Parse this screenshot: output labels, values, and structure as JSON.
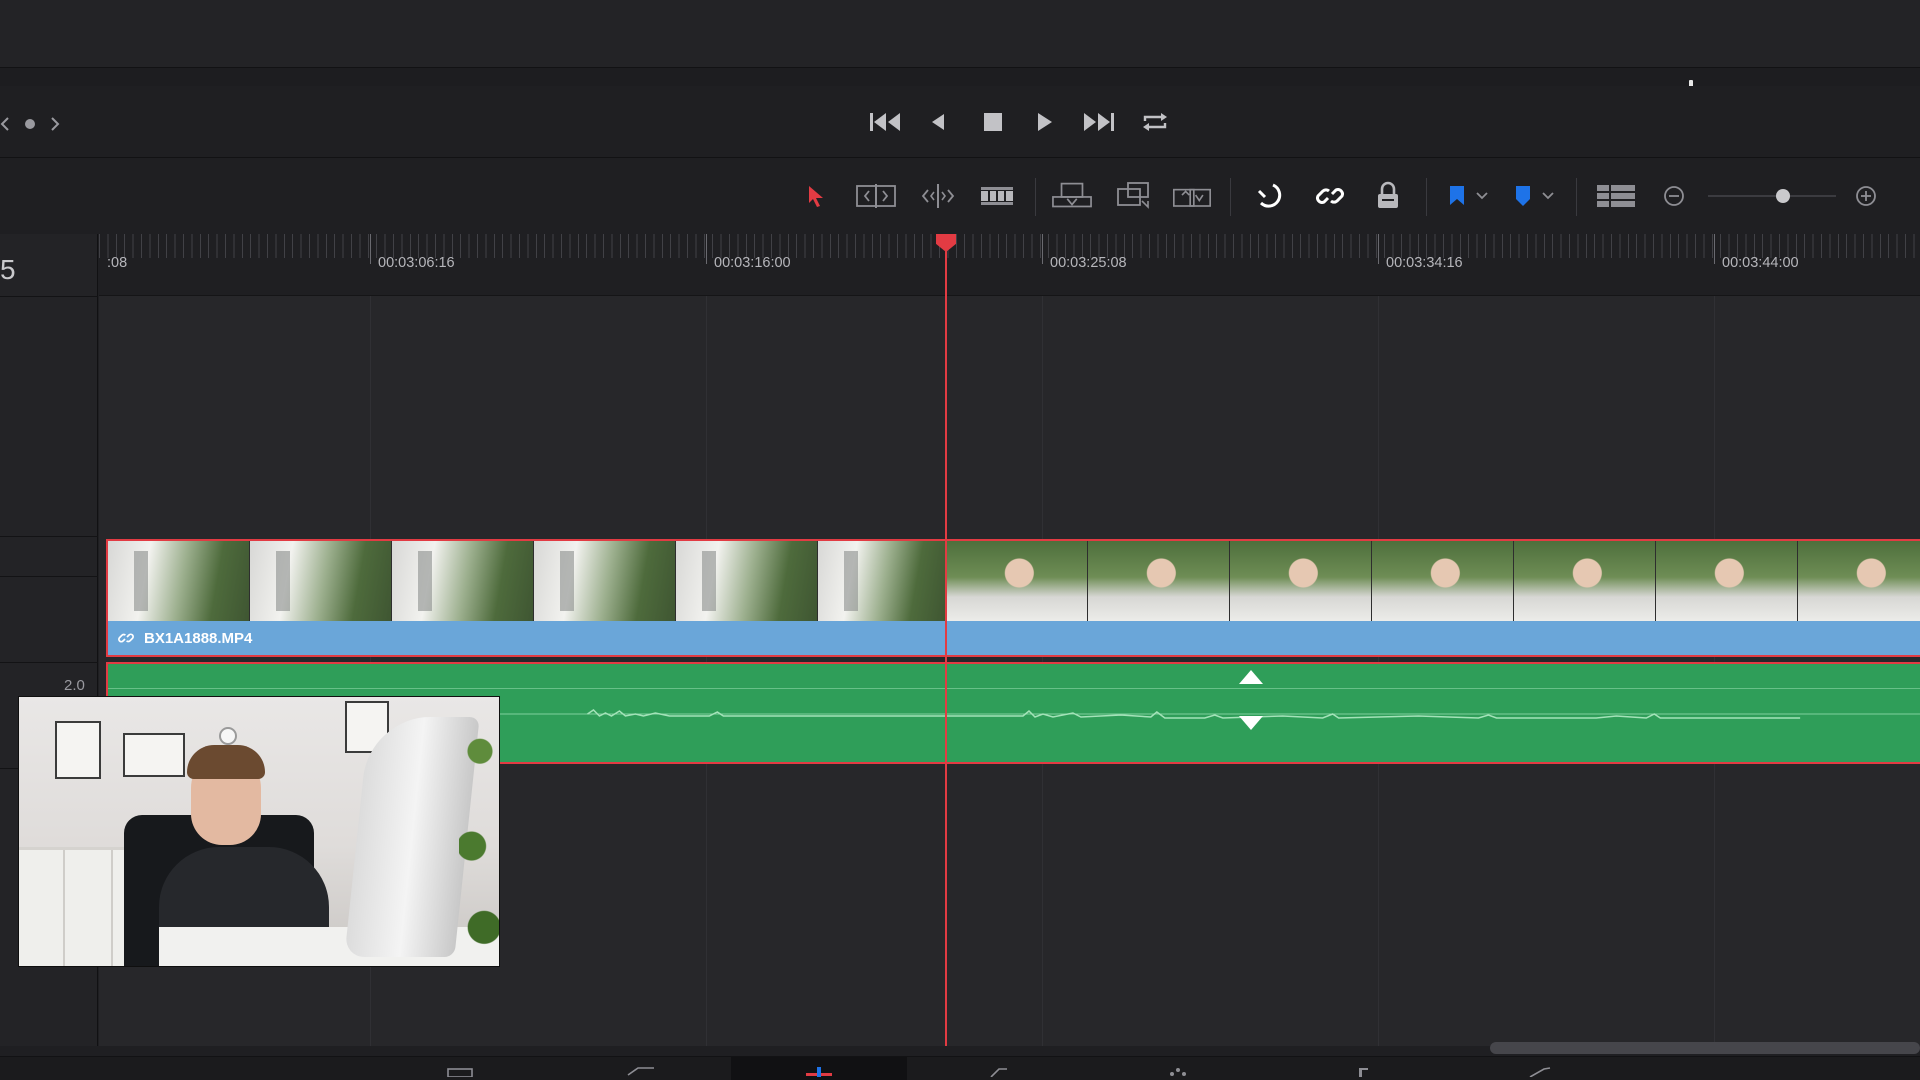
{
  "colors": {
    "accent_red": "#e23b43",
    "video_clip_blue": "#6aa6d9",
    "audio_clip_green": "#2f9e59",
    "flag_blue": "#1e73e8"
  },
  "transport": {
    "buttons": [
      "skip-to-start-icon",
      "step-back-icon",
      "stop-icon",
      "play-icon",
      "skip-to-end-icon",
      "loop-icon"
    ]
  },
  "toolbar": {
    "tools": [
      "selection-arrow-icon",
      "trim-edit-icon",
      "dynamic-trim-icon",
      "blade-icon",
      "insert-clip-icon",
      "overwrite-clip-icon",
      "replace-clip-icon",
      "snapping-icon",
      "linked-selection-icon",
      "position-lock-icon",
      "flag-icon",
      "marker-icon",
      "timeline-view-options-icon",
      "zoom-out-icon",
      "zoom-in-icon"
    ],
    "zoom_level": 0.6
  },
  "timeline": {
    "timecode_stub": "5",
    "ruler": ":08",
    "ruler_timecodes": [
      "00:03:06:16",
      "00:03:16:00",
      "00:03:25:08",
      "00:03:34:16",
      "00:03:44:00"
    ],
    "video_clip": {
      "name": "BX1A1888.MP4"
    },
    "audio_clip": {
      "level_label": "2.0"
    }
  },
  "page_bar": {
    "tabs": [
      "media-page-icon",
      "cut-page-icon",
      "edit-page-icon",
      "fusion-page-icon",
      "color-page-icon",
      "fairlight-page-icon",
      "deliver-page-icon"
    ],
    "active_tab": "edit-page-icon"
  },
  "webcam": {
    "subject": "presenter-overlay"
  }
}
